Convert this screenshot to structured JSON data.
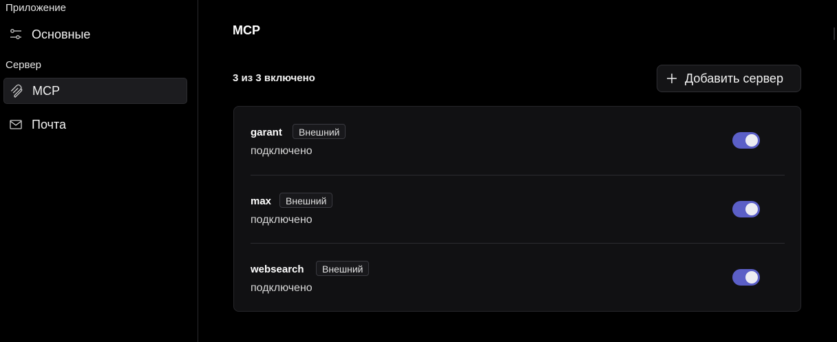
{
  "sidebar": {
    "app_section_label": "Приложение",
    "server_section_label": "Сервер",
    "items": [
      {
        "label": "Основные",
        "icon": "sliders-icon"
      },
      {
        "label": "MCP",
        "icon": "mcp-icon",
        "active": true
      },
      {
        "label": "Почта",
        "icon": "mail-icon"
      }
    ]
  },
  "main": {
    "title": "MCP",
    "enabled_count": "3 из 3 включено",
    "add_server_label": "Добавить сервер",
    "servers": [
      {
        "name": "garant",
        "badge": "Внешний",
        "status": "подключено",
        "enabled": true
      },
      {
        "name": "max",
        "badge": "Внешний",
        "status": "подключено",
        "enabled": true
      },
      {
        "name": "websearch",
        "badge": "Внешний",
        "status": "подключено",
        "enabled": true
      }
    ]
  },
  "colors": {
    "background": "#000000",
    "card": "#111113",
    "toggle_on": "#5b5fc7",
    "active_nav": "#1c1c1f"
  }
}
